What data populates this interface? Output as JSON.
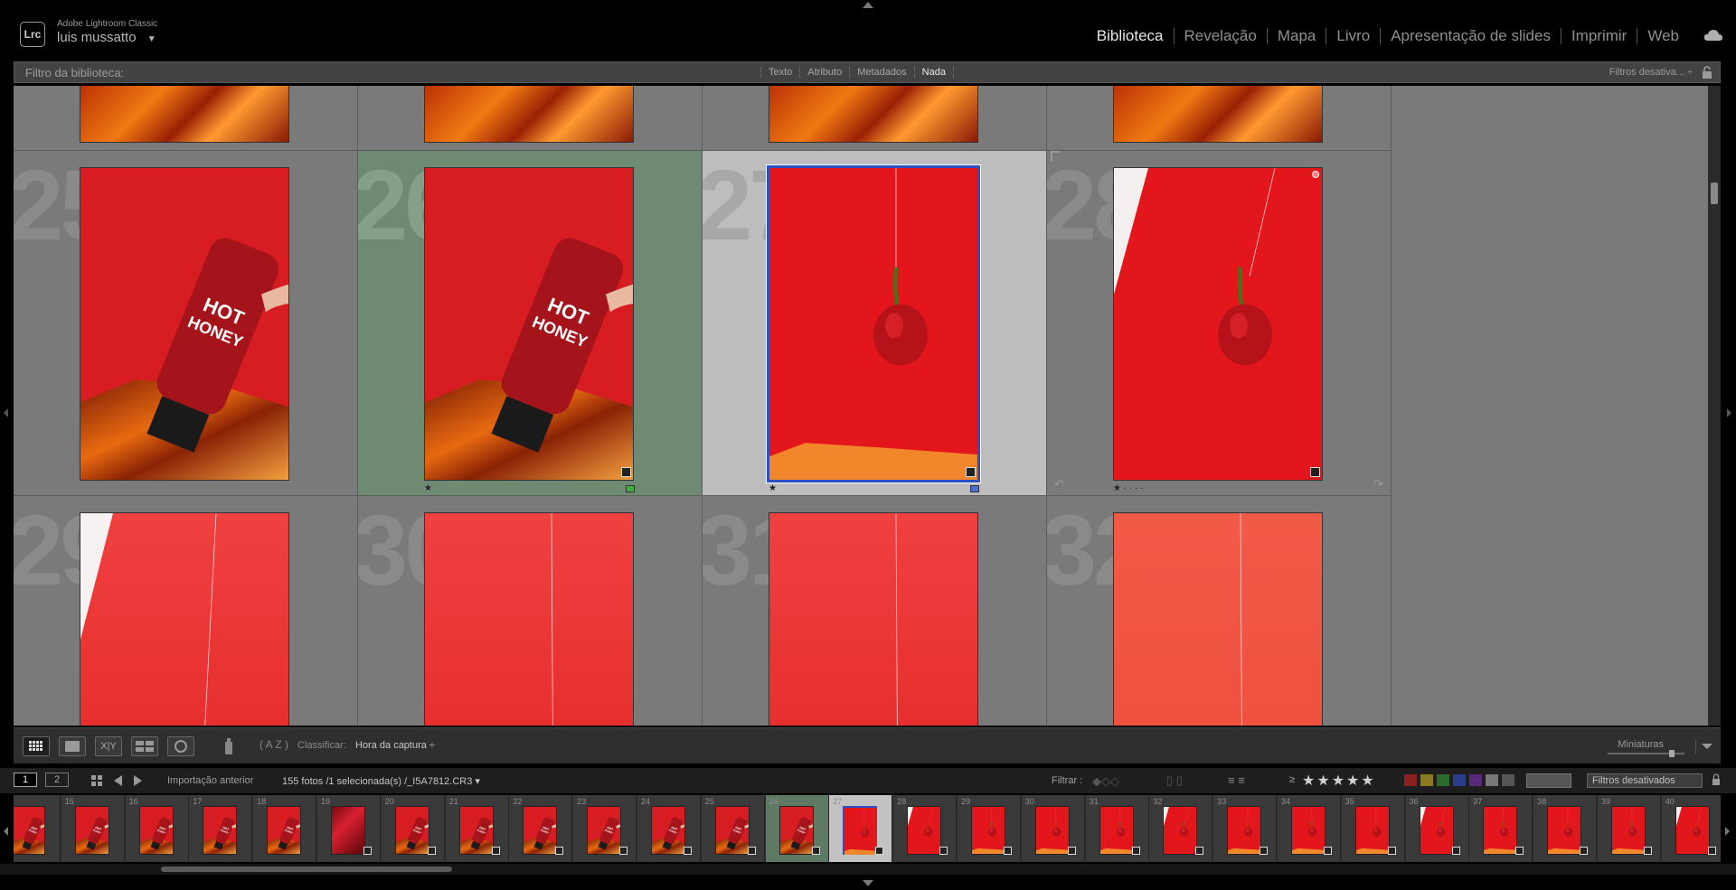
{
  "app": {
    "name": "Adobe Lightroom Classic",
    "logo_text": "Lrc",
    "user": "luis mussatto",
    "user_dropdown": "▼"
  },
  "modules": [
    {
      "label": "Biblioteca",
      "active": true
    },
    {
      "label": "Revelação",
      "active": false
    },
    {
      "label": "Mapa",
      "active": false
    },
    {
      "label": "Livro",
      "active": false
    },
    {
      "label": "Apresentação de slides",
      "active": false
    },
    {
      "label": "Imprimir",
      "active": false
    },
    {
      "label": "Web",
      "active": false
    }
  ],
  "library_filter": {
    "label": "Filtro da biblioteca:",
    "tabs": [
      "Texto",
      "Atributo",
      "Metadados",
      "Nada"
    ],
    "selected_tab": "Nada",
    "presets": "Filtros desativa... ÷"
  },
  "grid": {
    "rows": [
      {
        "cells": [
          {
            "number": "",
            "bg": "foil",
            "state": "normal"
          },
          {
            "number": "",
            "bg": "foil",
            "state": "normal"
          },
          {
            "number": "",
            "bg": "foil",
            "state": "normal"
          },
          {
            "number": "",
            "bg": "foil",
            "state": "normal"
          }
        ]
      },
      {
        "cells": [
          {
            "number": "25",
            "bg": "bottle",
            "state": "normal",
            "stars": "",
            "badge": false
          },
          {
            "number": "26",
            "bg": "bottle",
            "state": "green",
            "stars": "★",
            "badge": true,
            "color_label": "#3fae3f"
          },
          {
            "number": "27",
            "bg": "pepper",
            "state": "selected",
            "stars": "★",
            "badge": true,
            "color_label": "#4a6ed6"
          },
          {
            "number": "28",
            "bg": "pepper-wall",
            "state": "normal",
            "stars": "★ · · · ·",
            "badge": true
          }
        ]
      },
      {
        "cells": [
          {
            "number": "29",
            "bg": "lightred-wall",
            "state": "normal"
          },
          {
            "number": "30",
            "bg": "lightred",
            "state": "normal"
          },
          {
            "number": "31",
            "bg": "lightred",
            "state": "normal"
          },
          {
            "number": "32",
            "bg": "peach",
            "state": "normal"
          }
        ]
      }
    ]
  },
  "toolbar": {
    "sort_label": "Classificar:",
    "sort_value": "Hora da captura ÷",
    "thumbnails_label": "Miniaturas",
    "view_buttons": [
      "grid-view",
      "loupe-view",
      "compare-view",
      "survey-view",
      "people-view"
    ],
    "az_label": "A Z"
  },
  "info_bar": {
    "monitor1": "1",
    "monitor2": "2",
    "source": "Importação anterior",
    "count": "155 fotos /1 selecionada(s) /_I5A7812.CR3 ▾",
    "filter_label": "Filtrar :",
    "rating_op": "≥",
    "stars": "★★★★★",
    "filters_off": "Filtros desativados"
  },
  "filmstrip": {
    "items": [
      {
        "n": "",
        "kind": "bottle",
        "state": "normal"
      },
      {
        "n": "15",
        "kind": "bottle",
        "state": "normal"
      },
      {
        "n": "16",
        "kind": "bottle",
        "state": "normal"
      },
      {
        "n": "17",
        "kind": "bottle",
        "state": "normal"
      },
      {
        "n": "18",
        "kind": "bottle",
        "state": "normal"
      },
      {
        "n": "19",
        "kind": "foil",
        "state": "normal"
      },
      {
        "n": "20",
        "kind": "bottle",
        "state": "normal"
      },
      {
        "n": "21",
        "kind": "bottle",
        "state": "normal"
      },
      {
        "n": "22",
        "kind": "bottle",
        "state": "normal"
      },
      {
        "n": "23",
        "kind": "bottle",
        "state": "normal"
      },
      {
        "n": "24",
        "kind": "bottle",
        "state": "normal"
      },
      {
        "n": "25",
        "kind": "bottle",
        "state": "normal"
      },
      {
        "n": "26",
        "kind": "bottle",
        "state": "green"
      },
      {
        "n": "27",
        "kind": "pepper",
        "state": "selected"
      },
      {
        "n": "28",
        "kind": "pepper",
        "state": "normal"
      },
      {
        "n": "29",
        "kind": "pepper",
        "state": "normal"
      },
      {
        "n": "30",
        "kind": "pepper",
        "state": "normal"
      },
      {
        "n": "31",
        "kind": "pepper",
        "state": "normal"
      },
      {
        "n": "32",
        "kind": "pepper",
        "state": "normal"
      },
      {
        "n": "33",
        "kind": "pepper",
        "state": "normal"
      },
      {
        "n": "34",
        "kind": "pepper",
        "state": "normal"
      },
      {
        "n": "35",
        "kind": "pepper",
        "state": "normal"
      },
      {
        "n": "36",
        "kind": "pepper",
        "state": "normal"
      },
      {
        "n": "37",
        "kind": "pepper",
        "state": "normal"
      },
      {
        "n": "38",
        "kind": "pepper",
        "state": "normal"
      },
      {
        "n": "39",
        "kind": "pepper",
        "state": "normal"
      },
      {
        "n": "40",
        "kind": "pepper",
        "state": "normal"
      }
    ]
  },
  "colors": {
    "panel": "#434343",
    "grid_bg": "#7a7a7a",
    "selected_cell": "#bdbdbd",
    "green_label_cell": "#6f8a73",
    "selection_border": "#2d4fc2"
  }
}
